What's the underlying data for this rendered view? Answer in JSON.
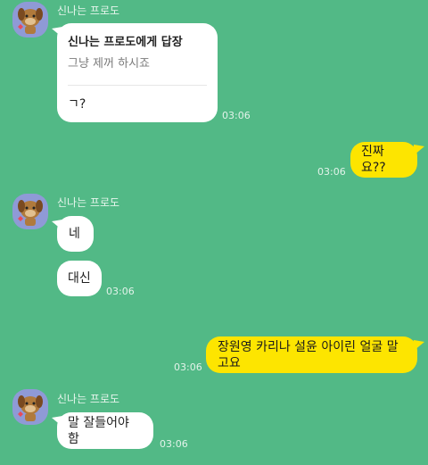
{
  "chat": {
    "messages": [
      {
        "sender": "신나는 프로도",
        "reply": {
          "header": "신나는 프로도에게 답장",
          "quoted": "그냥 제꺼 하시죠"
        },
        "text": "ㄱ?",
        "time": "03:06"
      },
      {
        "text": "진짜요??",
        "time": "03:06"
      },
      {
        "sender": "신나는 프로도",
        "text": "네"
      },
      {
        "text": "대신",
        "time": "03:06"
      },
      {
        "text": "장원영 카리나 설윤 아이린 얼굴 말고요",
        "time": "03:06"
      },
      {
        "sender": "신나는 프로도",
        "text": "말 잘들어야 함",
        "time": "03:06"
      }
    ]
  },
  "icons": {
    "avatar": "frodo-dog-avatar-icon"
  },
  "colors": {
    "background": "#52b986",
    "incoming_bubble": "#ffffff",
    "outgoing_bubble": "#fde500",
    "avatar_bg": "#8f9ad6"
  }
}
